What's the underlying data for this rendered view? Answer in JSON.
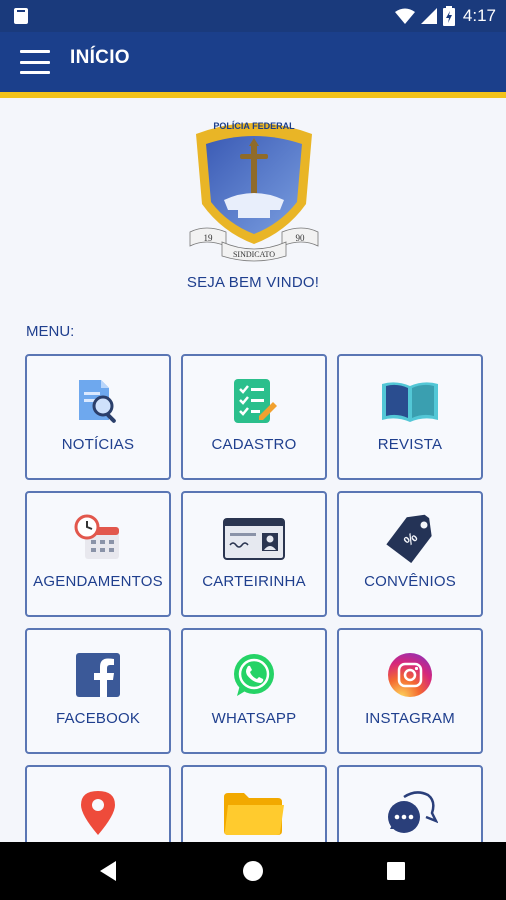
{
  "status_bar": {
    "time": "4:17",
    "icons": [
      "sd-card-icon",
      "wifi-icon",
      "signal-icon",
      "battery-icon"
    ]
  },
  "app_bar": {
    "title": "INÍCIO",
    "menu_icon": "hamburger-menu-icon"
  },
  "emblem": {
    "top_text": "POLÍCIA FEDERAL",
    "year_left": "19",
    "year_right": "90",
    "bottom_text": "SINDICATO"
  },
  "welcome": "SEJA BEM VINDO!",
  "menu_label": "MENU:",
  "tiles": [
    {
      "label": "NOTÍCIAS",
      "icon": "news-search-icon"
    },
    {
      "label": "CADASTRO",
      "icon": "checklist-icon"
    },
    {
      "label": "REVISTA",
      "icon": "open-book-icon"
    },
    {
      "label": "AGENDAMENTOS",
      "icon": "calendar-clock-icon"
    },
    {
      "label": "CARTEIRINHA",
      "icon": "id-card-icon"
    },
    {
      "label": "CONVÊNIOS",
      "icon": "discount-tag-icon"
    },
    {
      "label": "FACEBOOK",
      "icon": "facebook-icon"
    },
    {
      "label": "WHATSAPP",
      "icon": "whatsapp-icon"
    },
    {
      "label": "INSTAGRAM",
      "icon": "instagram-icon"
    },
    {
      "label": "",
      "icon": "location-pin-icon"
    },
    {
      "label": "",
      "icon": "folder-icon"
    },
    {
      "label": "",
      "icon": "chat-bubbles-icon"
    }
  ],
  "colors": {
    "primary": "#1b3f8b",
    "accent": "#f2c21a",
    "text": "#1f3f8e",
    "tile_border": "#5a76b4"
  }
}
